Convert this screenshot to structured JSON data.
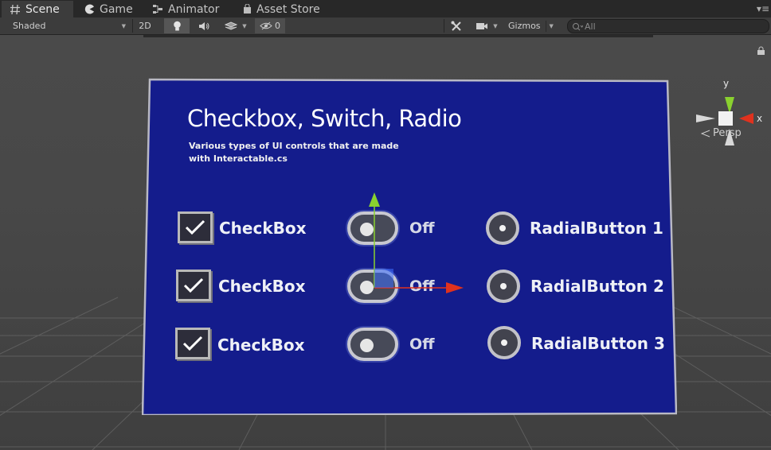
{
  "tabs": [
    {
      "label": "Scene",
      "icon": "hash-icon",
      "active": true
    },
    {
      "label": "Game",
      "icon": "pacman-icon"
    },
    {
      "label": "Animator",
      "icon": "animator-icon"
    },
    {
      "label": "Asset Store",
      "icon": "shopping-bag-icon"
    }
  ],
  "toolbar": {
    "draw_mode": "Shaded",
    "mode_2d": "2D",
    "lighting_icon": "light-bulb-icon",
    "audio_icon": "speaker-icon",
    "effects_icon": "effects-layers-icon",
    "hidden_count": "0",
    "tools_icon": "crossed-tools-icon",
    "camera_icon": "camera-icon",
    "gizmos": "Gizmos",
    "search_placeholder": "All"
  },
  "scene": {
    "view_mode": "Persp",
    "axis_y": "y",
    "axis_x": "x",
    "colors": {
      "panel": "#141c8c",
      "x_axis": "#e0321e",
      "y_axis": "#8ad12f",
      "background": "#484848"
    }
  },
  "panel": {
    "title": "Checkbox, Switch, Radio",
    "subtitle_line1": "Various types of UI controls that are made",
    "subtitle_line2": "with Interactable.cs",
    "checkboxes": [
      "CheckBox",
      "CheckBox",
      "CheckBox"
    ],
    "switches": [
      "Off",
      "Off",
      "Off"
    ],
    "radios": [
      "RadialButton 1",
      "RadialButton 2",
      "RadialButton 3"
    ]
  }
}
